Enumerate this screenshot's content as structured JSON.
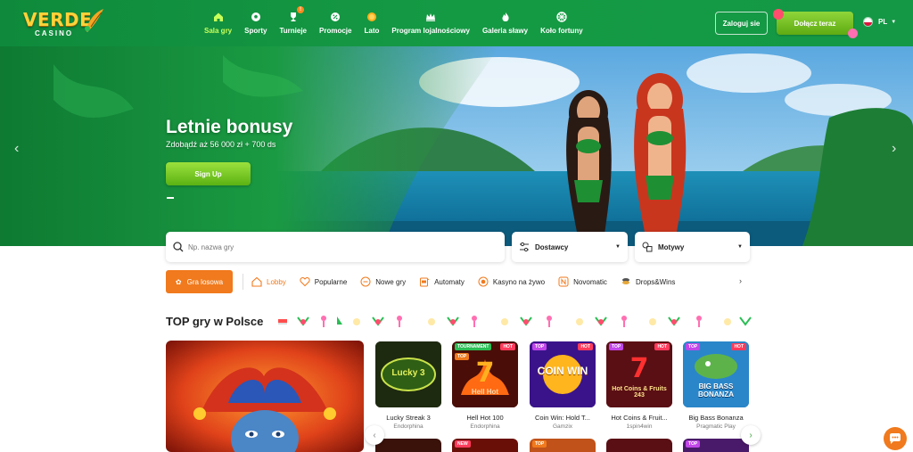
{
  "brand": {
    "name": "VERDE",
    "sub": "CASINO",
    "primary_green": "#149845",
    "accent_orange": "#f07a1d",
    "lime": "#c9ff5a"
  },
  "nav": {
    "items": [
      {
        "label": "Sala gry",
        "icon": "home-icon",
        "active": true
      },
      {
        "label": "Sporty",
        "icon": "soccer-ball-icon"
      },
      {
        "label": "Turnieje",
        "icon": "trophy-icon"
      },
      {
        "label": "Promocje",
        "icon": "percent-icon"
      },
      {
        "label": "Lato",
        "icon": "sun-icon"
      },
      {
        "label": "Program lojalnościowy",
        "icon": "crown-icon"
      },
      {
        "label": "Galeria sławy",
        "icon": "flame-icon"
      },
      {
        "label": "Koło fortuny",
        "icon": "wheel-icon"
      }
    ]
  },
  "header": {
    "login_label": "Zaloguj sie",
    "join_label": "Dołącz teraz",
    "lang_label": "PL"
  },
  "hero": {
    "title": "Letnie bonusy",
    "subtitle": "Zdobądź aż 56 000 zł + 700 ds",
    "cta_label": "Sign Up",
    "prev_arrow": "‹",
    "next_arrow": "›"
  },
  "search": {
    "placeholder": "Np. nazwa gry"
  },
  "filters": {
    "providers_label": "Dostawcy",
    "themes_label": "Motywy"
  },
  "categories": {
    "random_label": "Gra losowa",
    "items": [
      {
        "label": "Lobby",
        "icon": "home-icon",
        "active": true
      },
      {
        "label": "Popularne",
        "icon": "heart-icon"
      },
      {
        "label": "Nowe gry",
        "icon": "minus-circle-icon"
      },
      {
        "label": "Automaty",
        "icon": "slot-machine-icon"
      },
      {
        "label": "Kasyno na żywo",
        "icon": "record-icon"
      },
      {
        "label": "Novomatic",
        "icon": "n-badge-icon"
      },
      {
        "label": "Drops&Wins",
        "icon": "coins-icon"
      }
    ],
    "more_arrow": "›"
  },
  "top_games": {
    "title": "TOP gry w Polsce",
    "games": [
      {
        "name": "Lucky Streak 3",
        "provider": "Endorphina",
        "art_text": "Lucky 3",
        "tags": []
      },
      {
        "name": "Hell Hot 100",
        "provider": "Endorphina",
        "art_text": "Hell Hot",
        "tags": [
          "TOURNAMENT",
          "HOT",
          "TOP"
        ]
      },
      {
        "name": "Coin Win: Hold T...",
        "provider": "Gamzix",
        "art_text": "COIN WIN",
        "tags": [
          "TOP",
          "HOT"
        ]
      },
      {
        "name": "Hot Coins & Fruit...",
        "provider": "1spin4win",
        "art_text": "Hot Coins & Fruits 243",
        "tags": [
          "TOP",
          "HOT"
        ]
      },
      {
        "name": "Big Bass Bonanza",
        "provider": "Pragmatic Play",
        "art_text": "BIG BASS BONANZA",
        "tags": [
          "TOP",
          "HOT"
        ]
      }
    ],
    "bottom_tags": [
      "NEW",
      "TOP",
      "TOP"
    ]
  },
  "controls": {
    "left_arrow": "‹",
    "right_arrow": "›"
  }
}
